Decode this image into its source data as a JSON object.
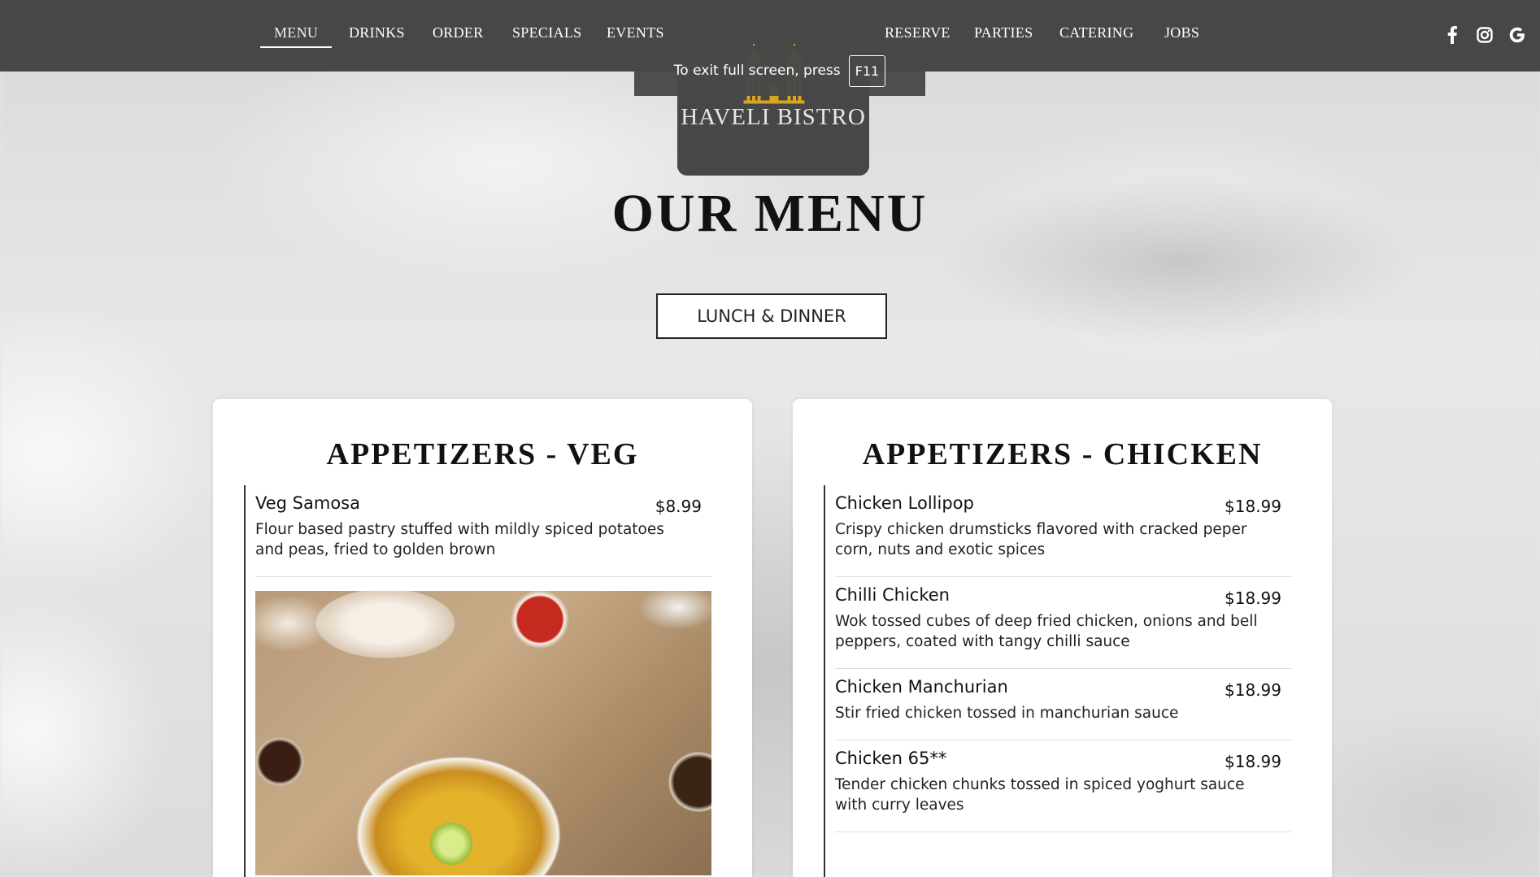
{
  "nav": {
    "left": [
      "MENU",
      "DRINKS",
      "ORDER",
      "SPECIALS",
      "EVENTS"
    ],
    "right": [
      "RESERVE",
      "PARTIES",
      "CATERING",
      "JOBS"
    ],
    "active": "MENU"
  },
  "social_icons": [
    "facebook-icon",
    "instagram-icon",
    "google-icon"
  ],
  "logo": {
    "text": "Haveli Bistro"
  },
  "fullscreen_toast": {
    "message": "To exit full screen, press",
    "key": "F11"
  },
  "page": {
    "title": "OUR MENU",
    "menu_button": "LUNCH & DINNER"
  },
  "sections": [
    {
      "title": "APPETIZERS - VEG",
      "items": [
        {
          "name": "Veg Samosa",
          "price": "$8.99",
          "desc": "Flour based pastry stuffed with mildly spiced potatoes and peas, fried to golden brown"
        }
      ]
    },
    {
      "title": "APPETIZERS - CHICKEN",
      "items": [
        {
          "name": "Chicken Lollipop",
          "price": "$18.99",
          "desc": "Crispy chicken drumsticks flavored with cracked peper corn, nuts and exotic spices"
        },
        {
          "name": "Chilli Chicken",
          "price": "$18.99",
          "desc": "Wok tossed cubes of deep fried chicken, onions and bell peppers, coated with tangy chilli sauce"
        },
        {
          "name": "Chicken Manchurian",
          "price": "$18.99",
          "desc": "Stir fried chicken tossed in manchurian sauce"
        },
        {
          "name": "Chicken 65**",
          "price": "$18.99",
          "desc": "Tender chicken chunks tossed in spiced yoghurt sauce with curry leaves"
        }
      ]
    }
  ],
  "colors": {
    "nav_bg": "#474747",
    "text": "#111111",
    "logo_gold": "#d9a521"
  }
}
